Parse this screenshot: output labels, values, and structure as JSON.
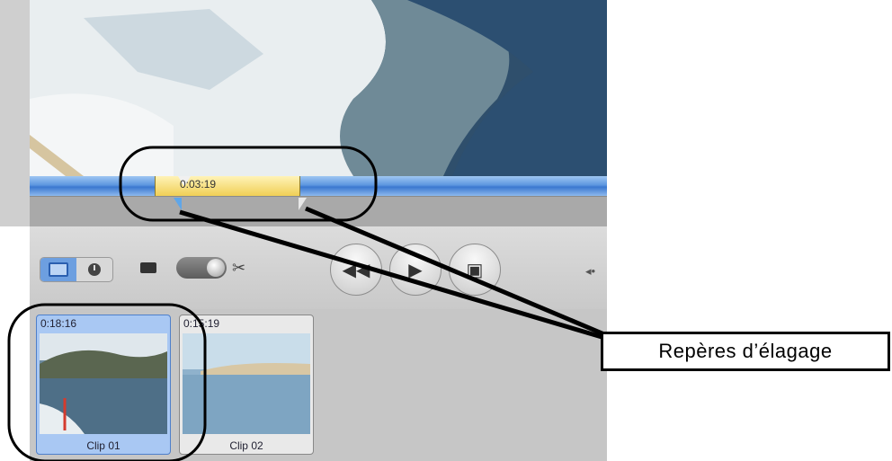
{
  "viewer": {
    "timecode": "0:03:19"
  },
  "controls": {
    "view_modes": [
      "clip-view",
      "time-view"
    ],
    "active_view": "clip-view"
  },
  "clips": [
    {
      "duration": "0:18:16",
      "name": "Clip 01",
      "selected": true
    },
    {
      "duration": "0:15:19",
      "name": "Clip 02",
      "selected": false
    }
  ],
  "annotation": {
    "label": "Repères d’élagage"
  },
  "colors": {
    "scrubber_blue": "#5d97e0",
    "trim_yellow": "#f0cf55",
    "selected_clip": "#a9c8f3"
  }
}
